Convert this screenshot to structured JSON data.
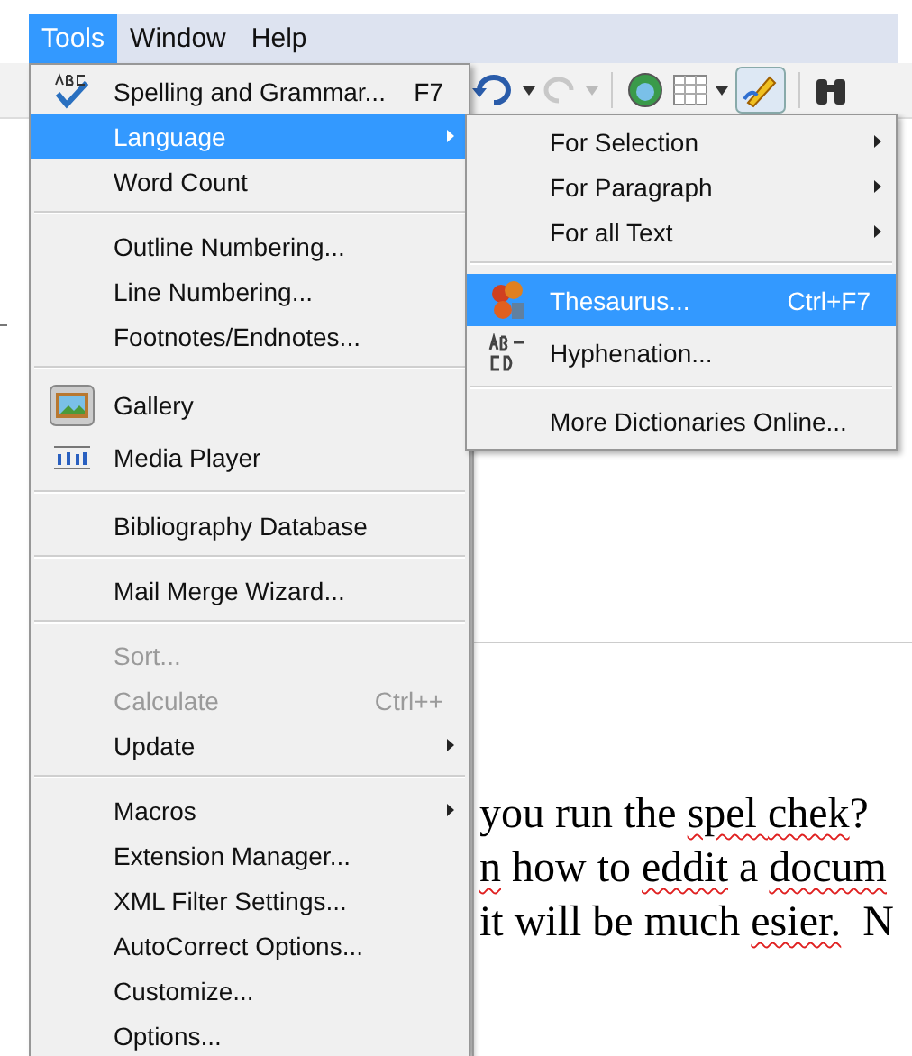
{
  "menubar": [
    {
      "label": "Tools",
      "selected": true
    },
    {
      "label": "Window",
      "selected": false
    },
    {
      "label": "Help",
      "selected": false
    }
  ],
  "tools_menu": [
    {
      "kind": "item",
      "label": "Spelling and Grammar...",
      "shortcut": "F7",
      "submenu": false,
      "disabled": false,
      "selected": false
    },
    {
      "kind": "item",
      "label": "Language",
      "submenu": true,
      "disabled": false,
      "selected": true
    },
    {
      "kind": "item",
      "label": "Word Count",
      "submenu": false,
      "disabled": false,
      "selected": false
    },
    {
      "kind": "separator"
    },
    {
      "kind": "item",
      "label": "Outline Numbering...",
      "submenu": false,
      "disabled": false,
      "selected": false
    },
    {
      "kind": "item",
      "label": "Line Numbering...",
      "submenu": false,
      "disabled": false,
      "selected": false
    },
    {
      "kind": "item",
      "label": "Footnotes/Endnotes...",
      "submenu": false,
      "disabled": false,
      "selected": false
    },
    {
      "kind": "separator"
    },
    {
      "kind": "item",
      "label": "Gallery",
      "submenu": false,
      "disabled": false,
      "selected": false
    },
    {
      "kind": "item",
      "label": "Media Player",
      "submenu": false,
      "disabled": false,
      "selected": false
    },
    {
      "kind": "separator"
    },
    {
      "kind": "item",
      "label": "Bibliography Database",
      "submenu": false,
      "disabled": false,
      "selected": false
    },
    {
      "kind": "separator"
    },
    {
      "kind": "item",
      "label": "Mail Merge Wizard...",
      "submenu": false,
      "disabled": false,
      "selected": false
    },
    {
      "kind": "separator"
    },
    {
      "kind": "item",
      "label": "Sort...",
      "submenu": false,
      "disabled": true,
      "selected": false
    },
    {
      "kind": "item",
      "label": "Calculate",
      "shortcut": "Ctrl++",
      "submenu": false,
      "disabled": true,
      "selected": false
    },
    {
      "kind": "item",
      "label": "Update",
      "submenu": true,
      "disabled": false,
      "selected": false
    },
    {
      "kind": "separator"
    },
    {
      "kind": "item",
      "label": "Macros",
      "submenu": true,
      "disabled": false,
      "selected": false
    },
    {
      "kind": "item",
      "label": "Extension Manager...",
      "submenu": false,
      "disabled": false,
      "selected": false
    },
    {
      "kind": "item",
      "label": "XML Filter Settings...",
      "submenu": false,
      "disabled": false,
      "selected": false
    },
    {
      "kind": "item",
      "label": "AutoCorrect Options...",
      "submenu": false,
      "disabled": false,
      "selected": false
    },
    {
      "kind": "item",
      "label": "Customize...",
      "submenu": false,
      "disabled": false,
      "selected": false
    },
    {
      "kind": "item",
      "label": "Options...",
      "submenu": false,
      "disabled": false,
      "selected": false
    }
  ],
  "language_submenu": [
    {
      "kind": "item",
      "label": "For Selection",
      "submenu": true,
      "selected": false
    },
    {
      "kind": "item",
      "label": "For Paragraph",
      "submenu": true,
      "selected": false
    },
    {
      "kind": "item",
      "label": "For all Text",
      "submenu": true,
      "selected": false
    },
    {
      "kind": "separator"
    },
    {
      "kind": "item",
      "label": "Thesaurus...",
      "shortcut": "Ctrl+F7",
      "submenu": false,
      "selected": true
    },
    {
      "kind": "item",
      "label": "Hyphenation...",
      "submenu": false,
      "selected": false
    },
    {
      "kind": "separator"
    },
    {
      "kind": "item",
      "label": "More Dictionaries Online...",
      "submenu": false,
      "selected": false
    }
  ],
  "document_lines": [
    [
      {
        "text": "you run the ",
        "misspelled": false
      },
      {
        "text": "spel ",
        "misspelled": true
      },
      {
        "text": "chek",
        "misspelled": true
      },
      {
        "text": "?",
        "misspelled": false
      }
    ],
    [
      {
        "text": "n",
        "misspelled": true
      },
      {
        "text": " how to ",
        "misspelled": false
      },
      {
        "text": "eddit",
        "misspelled": true
      },
      {
        "text": " a ",
        "misspelled": false
      },
      {
        "text": "docum",
        "misspelled": true
      }
    ],
    [
      {
        "text": "it will be much ",
        "misspelled": false
      },
      {
        "text": "esier.",
        "misspelled": true
      },
      {
        "text": "  N",
        "misspelled": false
      }
    ]
  ]
}
